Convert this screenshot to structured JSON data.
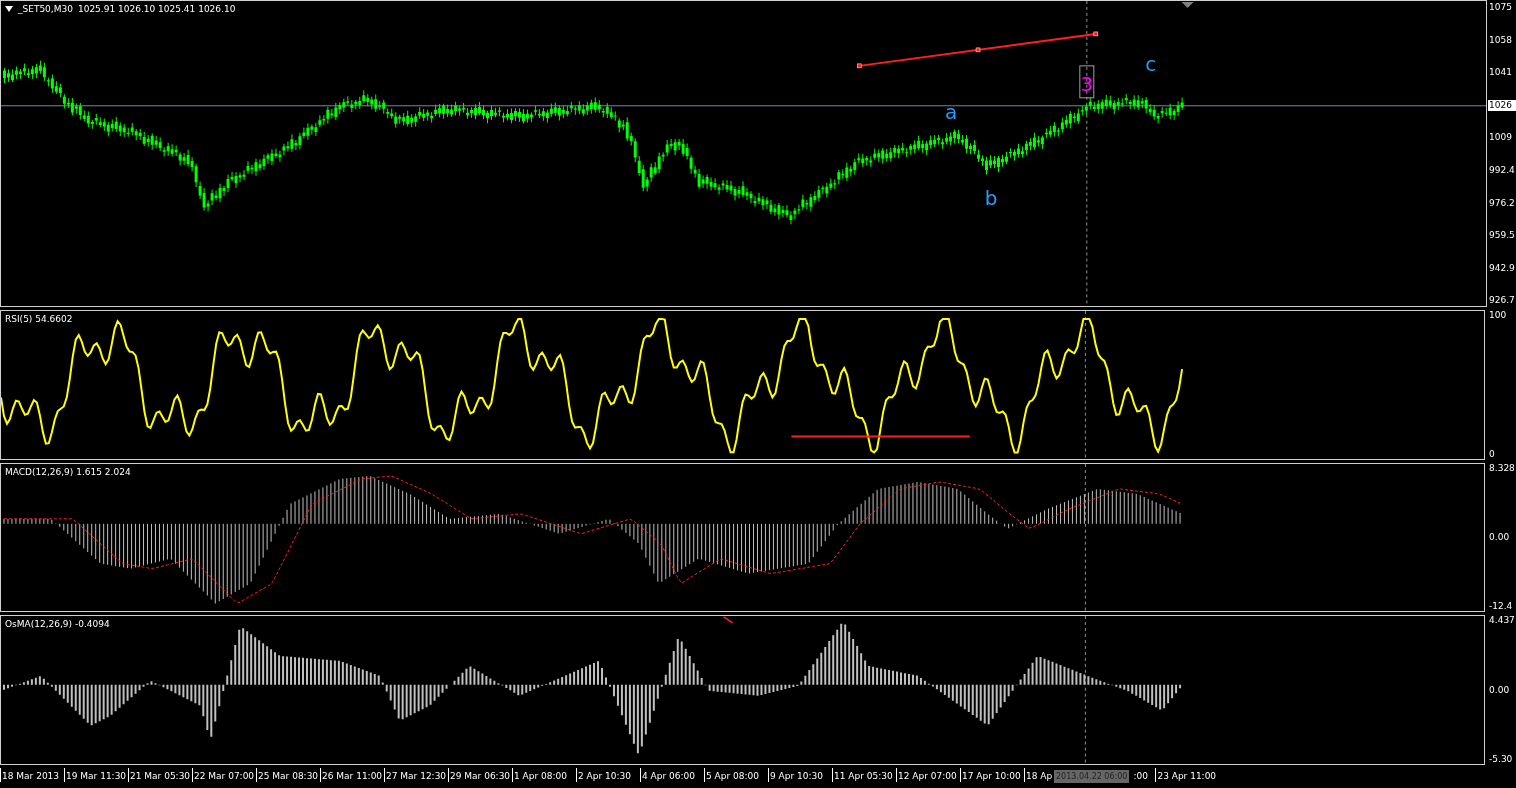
{
  "chart": {
    "symbol": "_SET50,M30",
    "ohlc": "1025.91 1026.10 1025.41 1026.10",
    "annotations": [
      {
        "text": "a",
        "color": "#1ea0ff",
        "boxed": false
      },
      {
        "text": "b",
        "color": "#1ea0ff",
        "boxed": false
      },
      {
        "text": "c",
        "color": "#1ea0ff",
        "boxed": false
      },
      {
        "text": "3",
        "color": "#ff00ff",
        "boxed": true
      }
    ],
    "price_axis": [
      {
        "label": "1075",
        "highlighted": false
      },
      {
        "label": "1058",
        "highlighted": false
      },
      {
        "label": "1041",
        "highlighted": false
      },
      {
        "label": "1026",
        "highlighted": true
      },
      {
        "label": "1009",
        "highlighted": false
      },
      {
        "label": "992.4",
        "highlighted": false
      },
      {
        "label": "976.2",
        "highlighted": false
      },
      {
        "label": "959.5",
        "highlighted": false
      },
      {
        "label": "942.9",
        "highlighted": false
      },
      {
        "label": "926.7",
        "highlighted": false
      }
    ]
  },
  "panes": [
    {
      "kind": "rsi",
      "title": "RSI(5) 54.6602",
      "axis": [
        "100",
        "0"
      ]
    },
    {
      "kind": "macd",
      "title": "MACD(12,26,9) 1.615 2.024",
      "axis": [
        "8.328",
        "0.00",
        "-12.4"
      ]
    },
    {
      "kind": "osma",
      "title": "OsMA(12,26,9) -0.4094",
      "axis": [
        "4.437",
        "0.00",
        "-5.30"
      ]
    }
  ],
  "time_axis": {
    "labels": [
      "18 Mar 2013",
      "19 Mar 11:30",
      "21 Mar 05:30",
      "22 Mar 07:00",
      "25 Mar 08:30",
      "26 Mar 11:00",
      "27 Mar 12:30",
      "29 Mar 06:30",
      "1 Apr 08:00",
      "2 Apr 10:30",
      "4 Apr 06:00",
      "5 Apr 08:00",
      "9 Apr 10:30",
      "11 Apr 05:30",
      "12 Apr 07:00",
      "17 Apr 10:00",
      "18 Ap"
    ],
    "cursor_label": "2013.04.22 06:00",
    "after_cursor": [
      ":00",
      "23 Apr 11:00"
    ]
  }
}
